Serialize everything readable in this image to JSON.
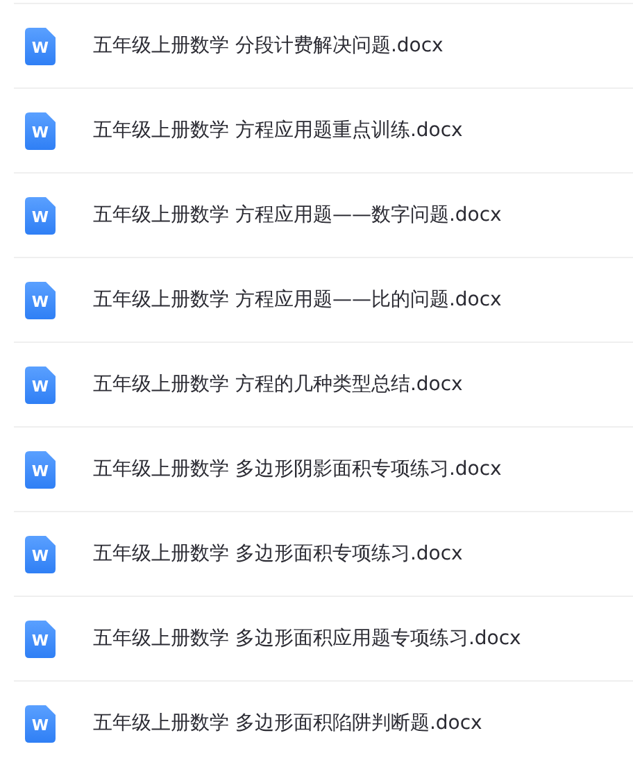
{
  "files": [
    {
      "name": "五年级上册数学 分段计费解决问题.docx",
      "icon_letter": "W"
    },
    {
      "name": "五年级上册数学 方程应用题重点训练.docx",
      "icon_letter": "W"
    },
    {
      "name": "五年级上册数学 方程应用题——数字问题.docx",
      "icon_letter": "W"
    },
    {
      "name": "五年级上册数学 方程应用题——比的问题.docx",
      "icon_letter": "W"
    },
    {
      "name": "五年级上册数学 方程的几种类型总结.docx",
      "icon_letter": "W"
    },
    {
      "name": "五年级上册数学 多边形阴影面积专项练习.docx",
      "icon_letter": "W"
    },
    {
      "name": "五年级上册数学 多边形面积专项练习.docx",
      "icon_letter": "W"
    },
    {
      "name": "五年级上册数学 多边形面积应用题专项练习.docx",
      "icon_letter": "W"
    },
    {
      "name": "五年级上册数学 多边形面积陷阱判断题.docx",
      "icon_letter": "W"
    }
  ]
}
